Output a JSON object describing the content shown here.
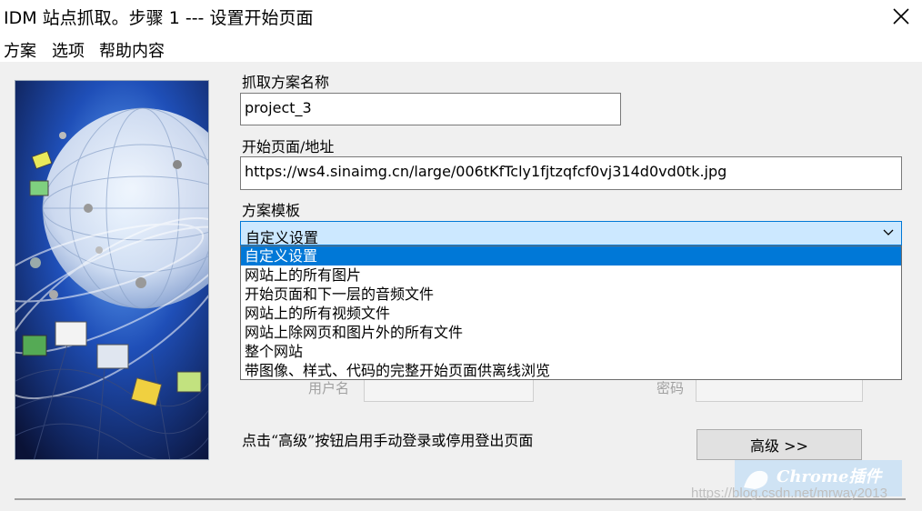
{
  "window": {
    "title": "IDM 站点抓取。步骤 1 --- 设置开始页面",
    "close_icon": "close-icon"
  },
  "menu": {
    "items": [
      {
        "label": "方案"
      },
      {
        "label": "选项"
      },
      {
        "label": "帮助内容"
      }
    ]
  },
  "form": {
    "project_name_label": "抓取方案名称",
    "project_name_value": "project_3",
    "start_url_label": "开始页面/地址",
    "start_url_value": "https://ws4.sinaimg.cn/large/006tKfTcly1fjtzqfcf0vj314d0vd0tk.jpg",
    "template_label": "方案模板",
    "template_selected": "自定义设置",
    "template_options": [
      "自定义设置",
      "网站上的所有图片",
      "开始页面和下一层的音频文件",
      "网站上的所有视频文件",
      "网站上除网页和图片外的所有文件",
      "整个网站",
      "带图像、样式、代码的完整开始页面供离线浏览"
    ],
    "username_label": "用户名",
    "password_label": "密码",
    "login_hint": "点击“高级”按钮启用手动登录或停用登出页面",
    "advanced_button": "高级 >>"
  },
  "watermark": {
    "brand": "Chrome插件",
    "url": "https://blog.csdn.net/mrway2013"
  },
  "colors": {
    "selection": "#0078d7",
    "combo_bg": "#cce8ff",
    "dialog_bg": "#f0f0f0"
  }
}
